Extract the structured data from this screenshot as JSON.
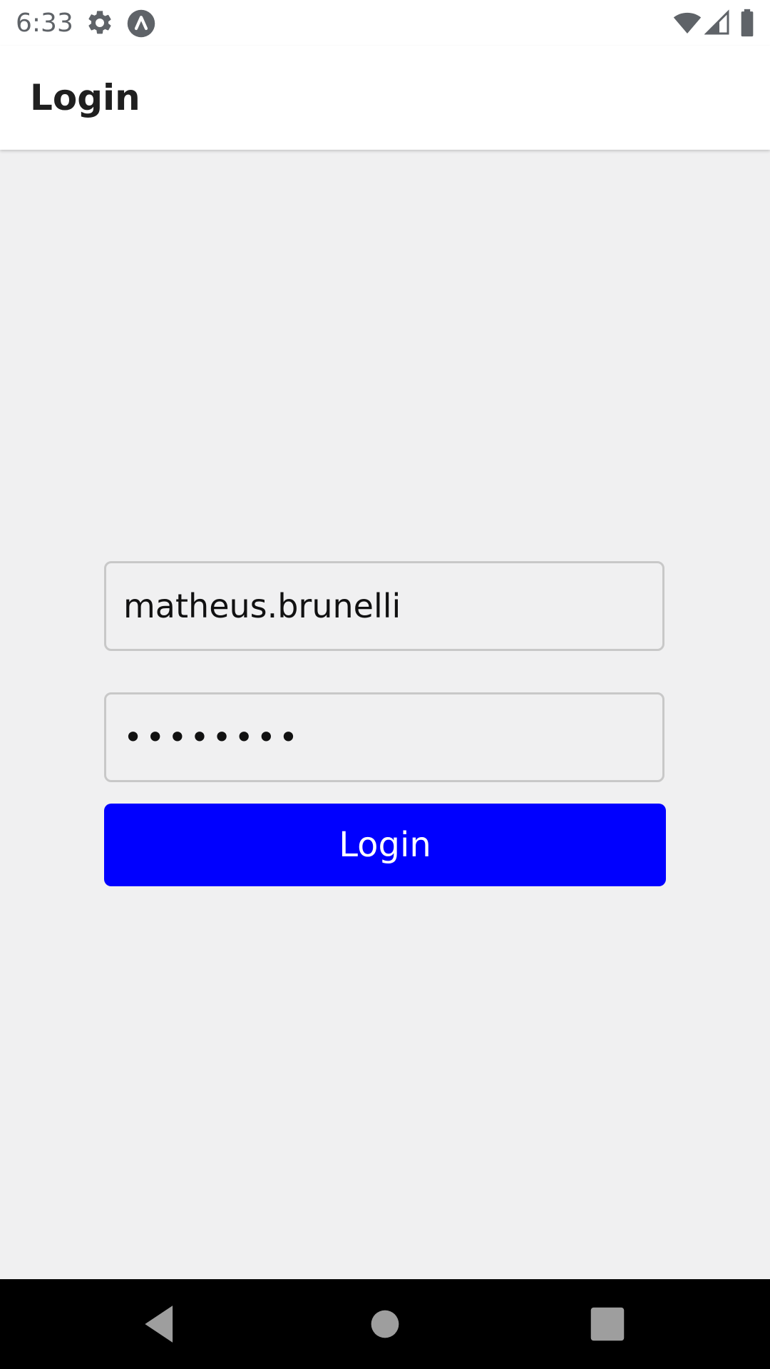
{
  "status_bar": {
    "time": "6:33",
    "icons": [
      "gear-icon",
      "app-notification-icon",
      "wifi-icon",
      "signal-icon",
      "battery-icon"
    ]
  },
  "app_bar": {
    "title": "Login"
  },
  "form": {
    "username_value": "matheus.brunelli",
    "password_value": "••••••••",
    "login_label": "Login"
  },
  "colors": {
    "button": "#0000ff",
    "background": "#f0f0f1",
    "nav_bar": "#000000"
  },
  "nav_bar": {
    "icons": [
      "back-icon",
      "home-icon",
      "recents-icon"
    ]
  }
}
